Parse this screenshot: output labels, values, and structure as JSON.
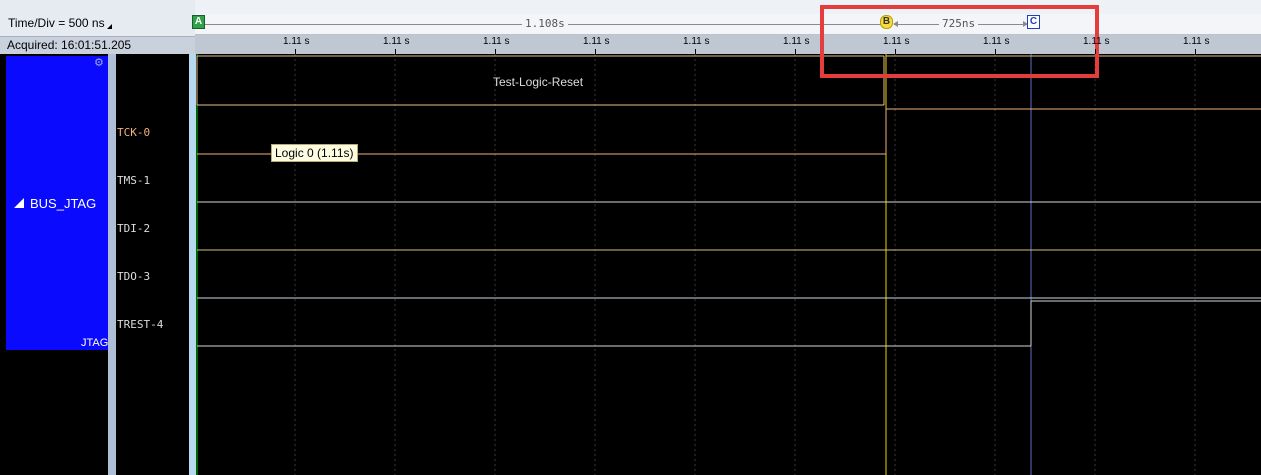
{
  "toolbar": {
    "time_div": "Time/Div = 500 ns",
    "acquired": "Acquired: 16:01:51.205"
  },
  "measurements": {
    "a_to_b": "1.108s",
    "b_to_c": "725ns"
  },
  "markers": {
    "a": "A",
    "b": "B",
    "c": "C"
  },
  "ruler": {
    "ticks": [
      "1.11 s",
      "1.11 s",
      "1.11 s",
      "1.11 s",
      "1.11 s",
      "1.11 s",
      "1.11 s",
      "1.11 s",
      "1.11 s",
      "1.11 s"
    ]
  },
  "bus": {
    "name": "BUS_JTAG",
    "protocol": "JTAG"
  },
  "signals": [
    {
      "name": "TCK-0"
    },
    {
      "name": "TMS-1"
    },
    {
      "name": "TDI-2"
    },
    {
      "name": "TDO-3"
    },
    {
      "name": "TREST-4"
    }
  ],
  "decode": {
    "state": "Test-Logic-Reset"
  },
  "tooltip": "Logic 0 (1.11s)",
  "colors": {
    "bus_block": "#0a0aff",
    "tck_trace": "#f0b27a",
    "state_trace": "#e8c28a",
    "other_trace": "#d6d6d6",
    "cursor_a": "#00c800",
    "cursor_b": "#f0d000",
    "cursor_c": "#1f3fbf",
    "highlight": "#e43d3d"
  }
}
